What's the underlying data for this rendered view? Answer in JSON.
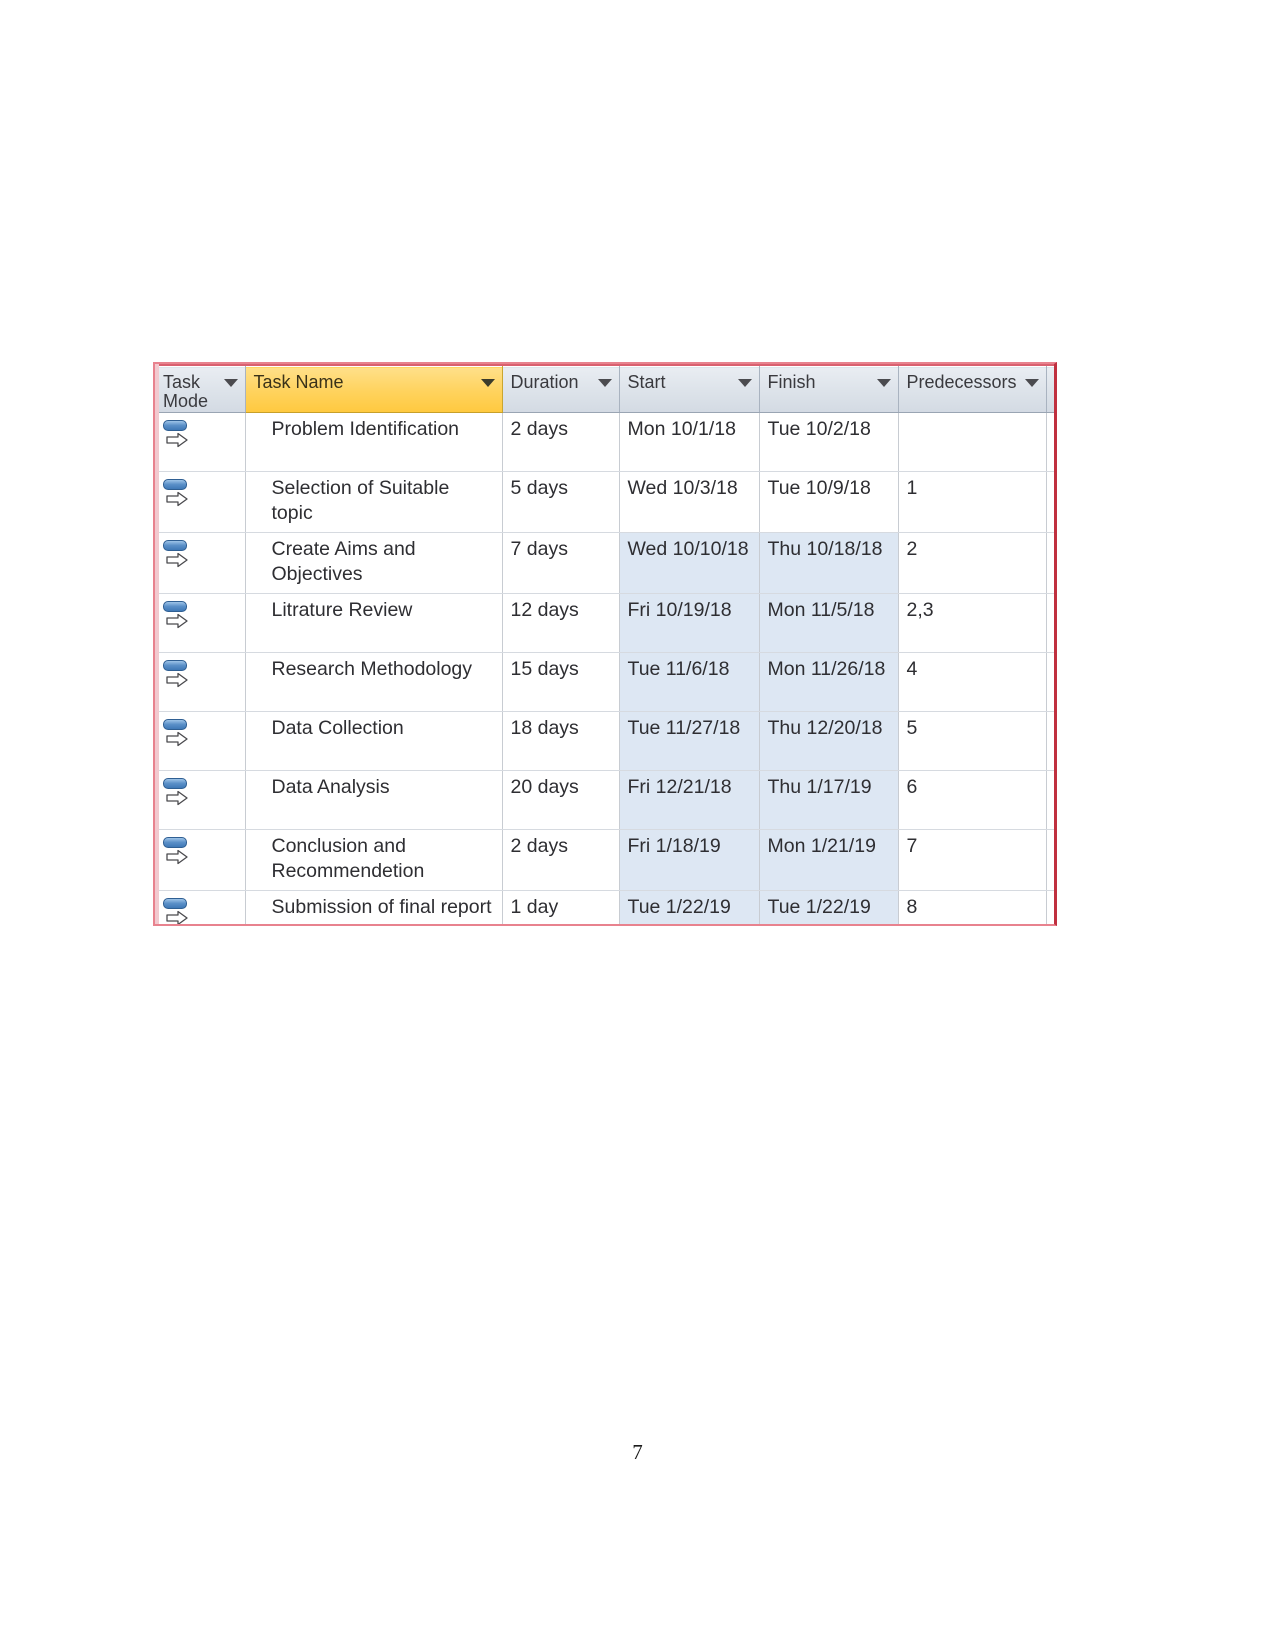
{
  "document": {
    "page_number": "7"
  },
  "table": {
    "columns": [
      {
        "key": "task_mode",
        "label": "Task Mode",
        "has_dropdown": true,
        "highlighted": false
      },
      {
        "key": "task_name",
        "label": "Task Name",
        "has_dropdown": true,
        "highlighted": true
      },
      {
        "key": "duration",
        "label": "Duration",
        "has_dropdown": true,
        "highlighted": false
      },
      {
        "key": "start",
        "label": "Start",
        "has_dropdown": true,
        "highlighted": false
      },
      {
        "key": "finish",
        "label": "Finish",
        "has_dropdown": true,
        "highlighted": false
      },
      {
        "key": "predecessors",
        "label": "Predecessors",
        "has_dropdown": true,
        "highlighted": false
      }
    ],
    "colors": {
      "header_background": "#dde3ea",
      "header_highlight": "#ffd25c",
      "cell_highlight": "#dde7f3",
      "capture_border": "#c0303f",
      "task_mode_icon": "#3f79b6"
    },
    "rows": [
      {
        "task_mode": "auto-scheduled-icon",
        "task_name": "Problem Identification",
        "duration": "2 days",
        "start": "Mon 10/1/18",
        "finish": "Tue 10/2/18",
        "predecessors": "",
        "date_highlight": false
      },
      {
        "task_mode": "auto-scheduled-icon",
        "task_name": "Selection of Suitable topic",
        "duration": "5 days",
        "start": "Wed 10/3/18",
        "finish": "Tue 10/9/18",
        "predecessors": "1",
        "date_highlight": false
      },
      {
        "task_mode": "auto-scheduled-icon",
        "task_name": "Create Aims and Objectives",
        "duration": "7 days",
        "start": "Wed 10/10/18",
        "finish": "Thu 10/18/18",
        "predecessors": "2",
        "date_highlight": true
      },
      {
        "task_mode": "auto-scheduled-icon",
        "task_name": "Litrature Review",
        "duration": "12 days",
        "start": "Fri 10/19/18",
        "finish": "Mon 11/5/18",
        "predecessors": "2,3",
        "date_highlight": true
      },
      {
        "task_mode": "auto-scheduled-icon",
        "task_name": "Research Methodology",
        "duration": "15 days",
        "start": "Tue 11/6/18",
        "finish": "Mon 11/26/18",
        "predecessors": "4",
        "date_highlight": true
      },
      {
        "task_mode": "auto-scheduled-icon",
        "task_name": "Data Collection",
        "duration": "18 days",
        "start": "Tue 11/27/18",
        "finish": "Thu 12/20/18",
        "predecessors": "5",
        "date_highlight": true
      },
      {
        "task_mode": "auto-scheduled-icon",
        "task_name": "Data Analysis",
        "duration": "20 days",
        "start": "Fri 12/21/18",
        "finish": "Thu 1/17/19",
        "predecessors": "6",
        "date_highlight": true
      },
      {
        "task_mode": "auto-scheduled-icon",
        "task_name": "Conclusion and Recommendetion",
        "duration": "2 days",
        "start": "Fri 1/18/19",
        "finish": "Mon 1/21/19",
        "predecessors": "7",
        "date_highlight": true
      },
      {
        "task_mode": "auto-scheduled-icon",
        "task_name": "Submission of final report",
        "duration": "1 day",
        "start": "Tue 1/22/19",
        "finish": "Tue 1/22/19",
        "predecessors": "8",
        "date_highlight": true
      }
    ]
  }
}
